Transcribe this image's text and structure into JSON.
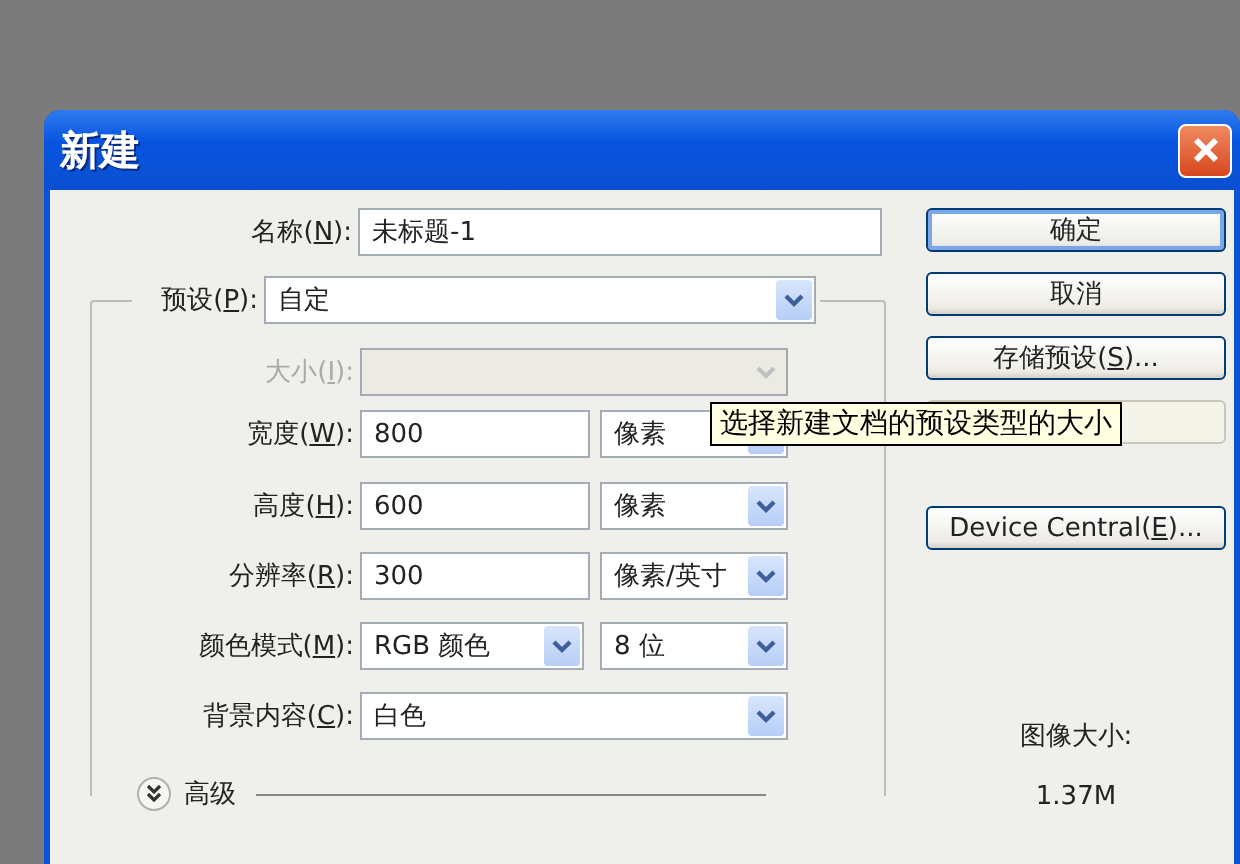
{
  "window": {
    "title": "新建"
  },
  "name_field": {
    "label": {
      "text": "名称(",
      "key": "N",
      "after": "):"
    },
    "value": "未标题-1"
  },
  "preset": {
    "label": {
      "text": "预设(",
      "key": "P",
      "after": "):"
    },
    "value": "自定"
  },
  "fields": [
    {
      "label": {
        "text": "大小(",
        "key": "I",
        "after": "):"
      },
      "kind": "select",
      "disabled": true
    },
    {
      "label": {
        "text": "宽度(",
        "key": "W",
        "after": "):"
      },
      "kind": "input",
      "value": "800",
      "disabled": false,
      "unit": {
        "value": "像素"
      }
    },
    {
      "label": {
        "text": "高度(",
        "key": "H",
        "after": "):"
      },
      "kind": "input",
      "value": "600",
      "disabled": false,
      "unit": {
        "value": "像素"
      }
    },
    {
      "label": {
        "text": "分辨率(",
        "key": "R",
        "after": "):"
      },
      "kind": "input",
      "value": "300",
      "disabled": false,
      "unit": {
        "value": "像素/英寸"
      }
    },
    {
      "label": {
        "text": "颜色模式(",
        "key": "M",
        "after": "):"
      },
      "kind": "select",
      "value": "RGB 颜色",
      "disabled": false,
      "unit": {
        "value": "8 位"
      }
    },
    {
      "label": {
        "text": "背景内容(",
        "key": "C",
        "after": "):"
      },
      "kind": "select",
      "value": "白色",
      "disabled": false
    }
  ],
  "advanced": {
    "label": "高级",
    "expanded": false
  },
  "buttons": [
    {
      "label": {
        "text": "确定"
      },
      "default": true,
      "disabled": false
    },
    {
      "label": {
        "text": "取消"
      },
      "default": false,
      "disabled": false
    },
    {
      "label": {
        "text": "存储预设(",
        "key": "S",
        "after": ")..."
      },
      "default": false,
      "disabled": false
    },
    {
      "default": false,
      "disabled": true
    },
    {
      "label": {
        "text": "Device Central(",
        "key": "E",
        "after": ")..."
      },
      "default": false,
      "disabled": false
    }
  ],
  "image_size": {
    "label": "图像大小:",
    "value": "1.37M"
  },
  "tooltip": "选择新建文档的预设类型的大小"
}
